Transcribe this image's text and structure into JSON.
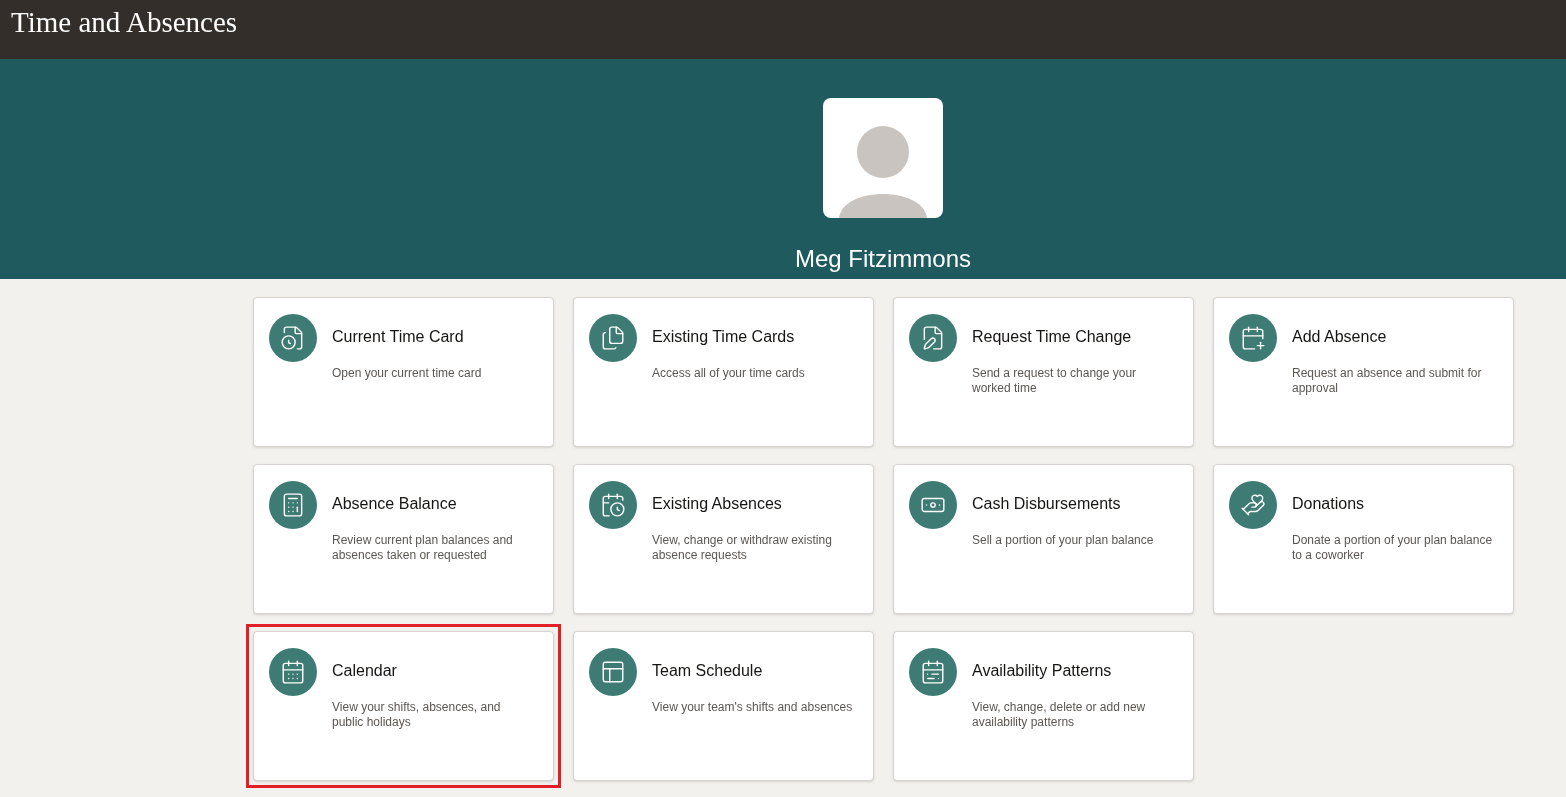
{
  "header": {
    "title": "Time and Absences"
  },
  "profile": {
    "name": "Meg Fitzimmons"
  },
  "tiles": [
    {
      "title": "Current Time Card",
      "description": "Open your current time card",
      "highlighted": false
    },
    {
      "title": "Existing Time Cards",
      "description": "Access all of your time cards",
      "highlighted": false
    },
    {
      "title": "Request Time Change",
      "description": "Send a request to change your worked time",
      "highlighted": false
    },
    {
      "title": "Add Absence",
      "description": "Request an absence and submit for approval",
      "highlighted": false
    },
    {
      "title": "Absence Balance",
      "description": "Review current plan balances and absences taken or requested",
      "highlighted": false
    },
    {
      "title": "Existing Absences",
      "description": "View, change or withdraw existing absence requests",
      "highlighted": false
    },
    {
      "title": "Cash Disbursements",
      "description": "Sell a portion of your plan balance",
      "highlighted": false
    },
    {
      "title": "Donations",
      "description": "Donate a portion of your plan balance to a coworker",
      "highlighted": false
    },
    {
      "title": "Calendar",
      "description": "View your shifts, absences, and public holidays",
      "highlighted": true
    },
    {
      "title": "Team Schedule",
      "description": "View your team's shifts and absences",
      "highlighted": false
    },
    {
      "title": "Availability Patterns",
      "description": "View, change, delete or add new availability patterns",
      "highlighted": false
    }
  ]
}
